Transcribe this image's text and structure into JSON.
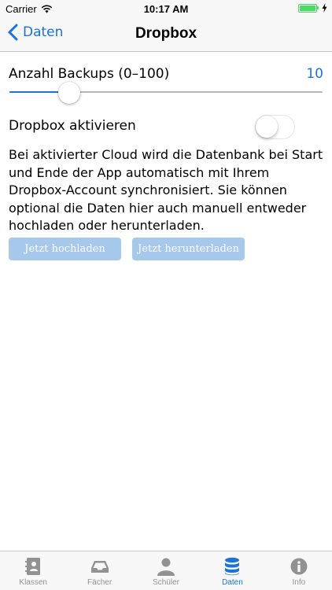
{
  "status_bar": {
    "carrier": "Carrier",
    "time": "10:17 AM"
  },
  "nav": {
    "back_label": "Daten",
    "title": "Dropbox"
  },
  "backups": {
    "label": "Anzahl Backups (0–100)",
    "value": "10",
    "slider_value": 10,
    "slider_min": 0,
    "slider_max": 100
  },
  "dropbox": {
    "label": "Dropbox aktivieren",
    "enabled": false
  },
  "description": "Bei aktivierter Cloud wird die Datenbank bei Start und Ende der App automatisch mit Ihrem Dropbox-Account synchronisiert. Sie können optional die Daten hier auch manuell entweder hochladen oder herunterladen.",
  "buttons": {
    "upload": "Jetzt hochladen",
    "download": "Jetzt herunterladen"
  },
  "tabs": [
    {
      "label": "Klassen",
      "icon": "contacts-book-icon",
      "active": false
    },
    {
      "label": "Fächer",
      "icon": "inbox-tray-icon",
      "active": false
    },
    {
      "label": "Schüler",
      "icon": "person-icon",
      "active": false
    },
    {
      "label": "Daten",
      "icon": "database-icon",
      "active": true
    },
    {
      "label": "Info",
      "icon": "info-icon",
      "active": false
    }
  ],
  "colors": {
    "accent": "#1a73d9",
    "button_disabled": "#a6c8ea",
    "tab_inactive": "#929292",
    "battery": "#4cd964"
  }
}
